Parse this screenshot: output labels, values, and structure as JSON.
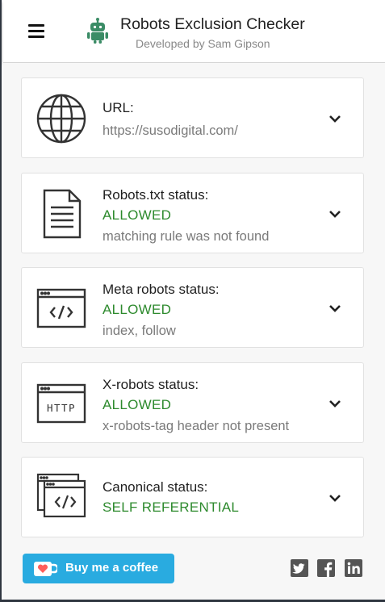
{
  "header": {
    "title": "Robots Exclusion Checker",
    "subtitle": "Developed by Sam Gipson",
    "menu_icon": "hamburger-menu-icon",
    "logo_icon": "android-robot-icon"
  },
  "colors": {
    "allowed": "#2d8a2d",
    "coffee_button": "#29abe0",
    "icon_stroke": "#333333"
  },
  "cards": [
    {
      "icon": "globe-icon",
      "label": "URL:",
      "detail": "https://susodigital.com/"
    },
    {
      "icon": "document-icon",
      "label": "Robots.txt status:",
      "status": "ALLOWED",
      "detail": "matching rule was not found"
    },
    {
      "icon": "code-window-icon",
      "label": "Meta robots status:",
      "status": "ALLOWED",
      "detail": "index, follow"
    },
    {
      "icon": "http-window-icon",
      "label": "X-robots status:",
      "status": "ALLOWED",
      "detail": "x-robots-tag header not present"
    },
    {
      "icon": "stacked-windows-icon",
      "label": "Canonical status:",
      "status": "SELF REFERENTIAL"
    }
  ],
  "footer": {
    "coffee_label": "Buy me a coffee",
    "coffee_icon": "coffee-cup-heart-icon",
    "social": [
      "twitter-icon",
      "facebook-icon",
      "linkedin-icon"
    ]
  }
}
